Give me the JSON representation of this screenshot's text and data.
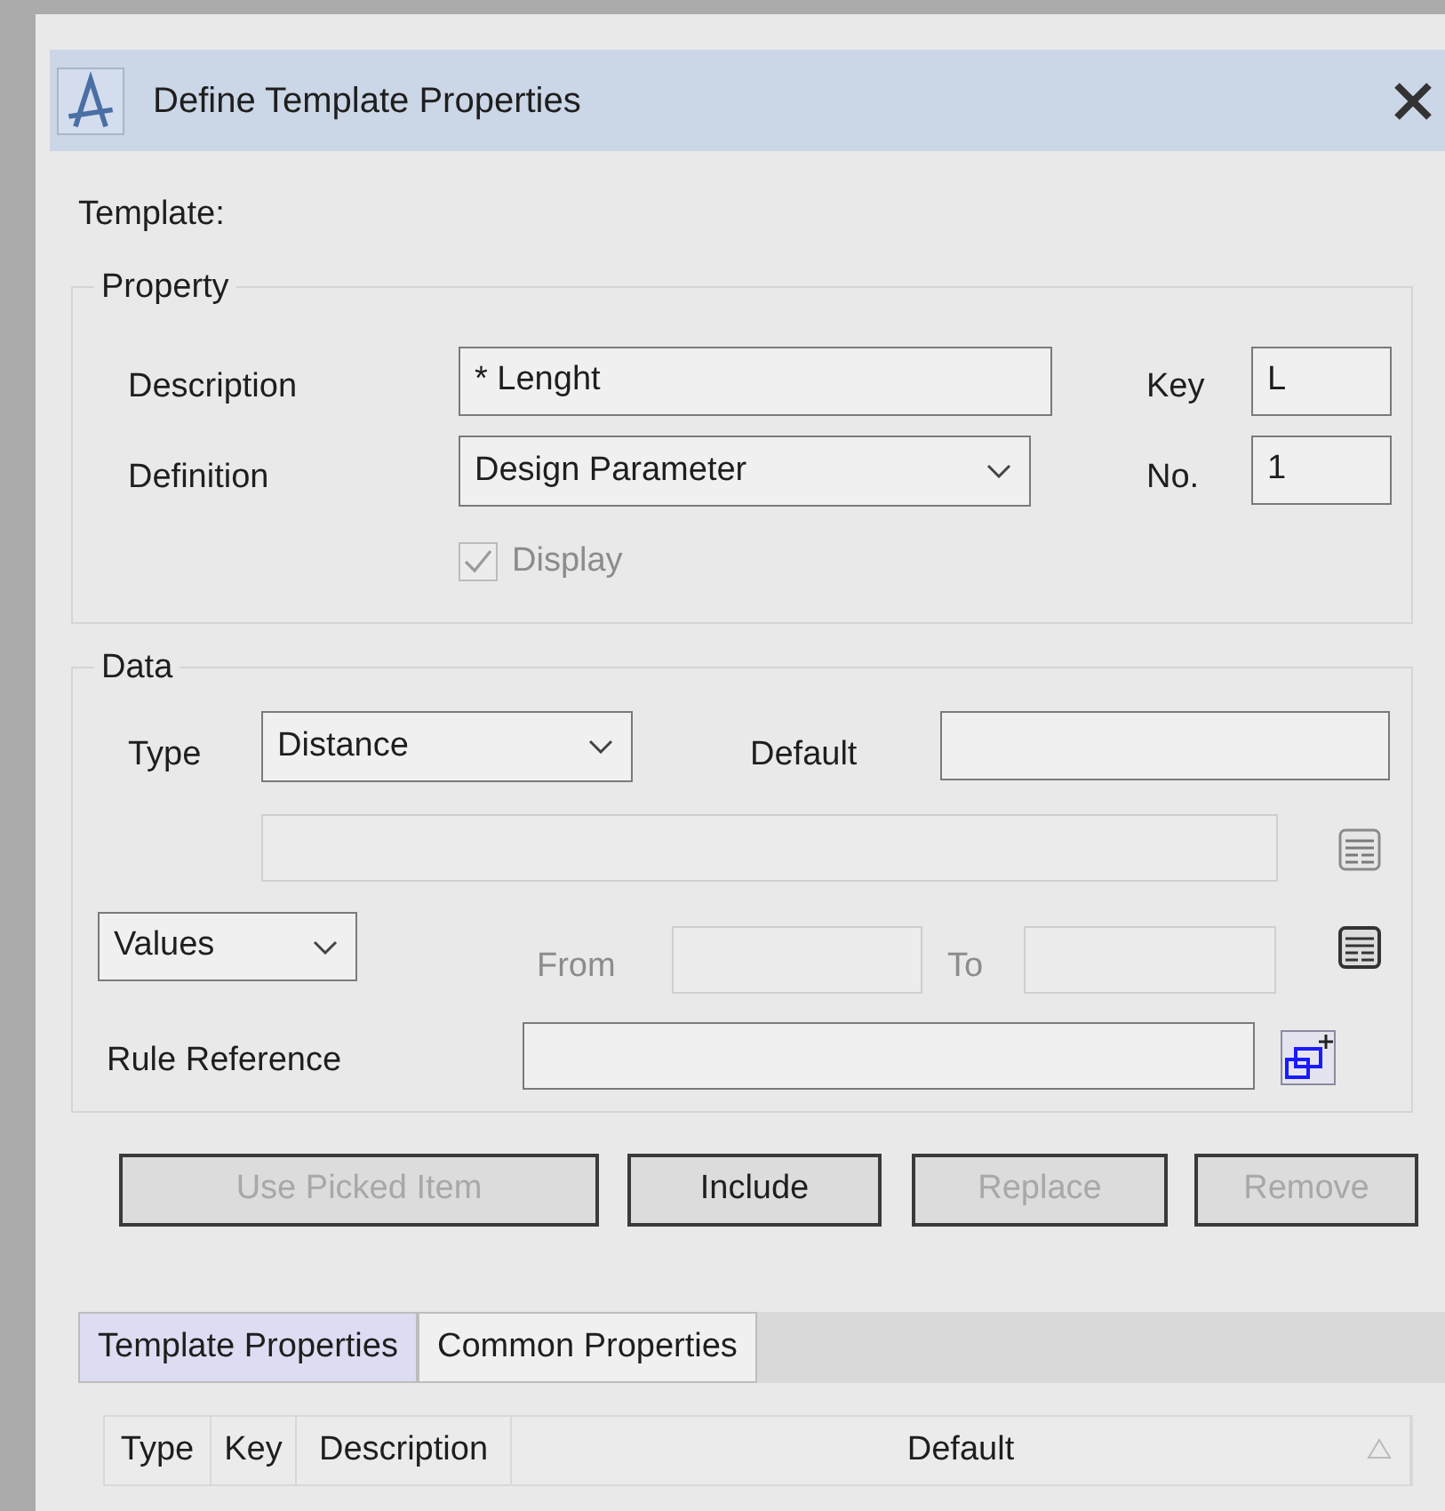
{
  "window": {
    "title": "Define Template Properties"
  },
  "template_label": "Template:",
  "property": {
    "legend": "Property",
    "description": {
      "label": "Description",
      "value": "* Lenght"
    },
    "key": {
      "label": "Key",
      "value": "L"
    },
    "definition": {
      "label": "Definition",
      "value": "Design Parameter"
    },
    "no": {
      "label": "No.",
      "value": "1"
    },
    "display": {
      "label": "Display",
      "checked": true,
      "disabled": true
    }
  },
  "data": {
    "legend": "Data",
    "type": {
      "label": "Type",
      "value": "Distance"
    },
    "default": {
      "label": "Default"
    },
    "values_dropdown": {
      "value": "Values"
    },
    "from": {
      "label": "From",
      "disabled": true
    },
    "to": {
      "label": "To",
      "disabled": true
    },
    "rule_reference": {
      "label": "Rule Reference"
    }
  },
  "buttons": [
    {
      "label": "Use Picked Item",
      "disabled": true
    },
    {
      "label": "Include",
      "disabled": false
    },
    {
      "label": "Replace",
      "disabled": true
    },
    {
      "label": "Remove",
      "disabled": true
    }
  ],
  "tabs": [
    {
      "label": "Template Properties",
      "selected": true
    },
    {
      "label": "Common Properties",
      "selected": false
    }
  ],
  "table": {
    "columns": [
      "Type",
      "Key",
      "Description",
      "Default"
    ]
  }
}
